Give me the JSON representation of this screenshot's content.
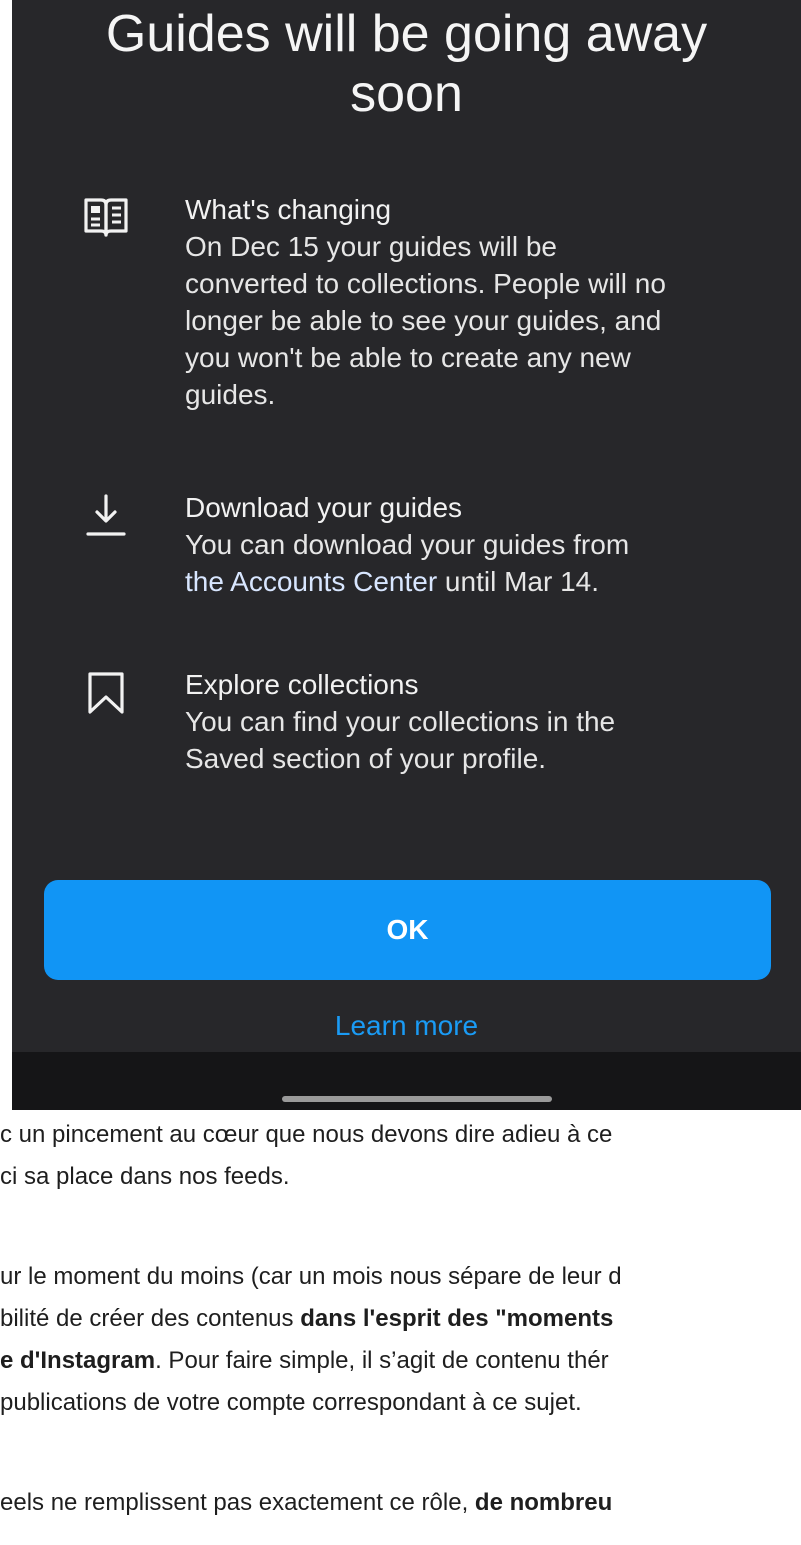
{
  "dialog": {
    "title_line1": "Guides will be going away",
    "title_line2": "soon",
    "items": [
      {
        "icon": "guide-book-icon",
        "heading": "What's changing",
        "body_lines": [
          "On Dec 15 your guides will be",
          "converted to collections. People will no",
          "longer be able to see your guides, and",
          "you won't be able to create any new",
          "guides."
        ]
      },
      {
        "icon": "download-icon",
        "heading": "Download your guides",
        "body_line1": "You can download your guides from",
        "body_line2_link": "the Accounts Center",
        "body_line2_rest": " until Mar 14."
      },
      {
        "icon": "bookmark-icon",
        "heading": "Explore collections",
        "body_lines": [
          "You can find your collections in the",
          "Saved section of your profile."
        ]
      }
    ],
    "ok_label": "OK",
    "learn_more_label": "Learn more"
  },
  "article": {
    "p1_line1": "c un pincement au cœur que nous devons dire adieu à ce",
    "p1_line2": "ci sa place dans nos feeds.",
    "p2_line1": "ur le moment du moins (car un mois nous sépare de leur d",
    "p2_line2_a": "bilité de créer des contenus ",
    "p2_line2_bold": "dans l'esprit des \"moments",
    "p2_line3_bold": "e d'Instagram",
    "p2_line3_b": ". Pour faire simple, il s’agit de contenu thér",
    "p2_line4": " publications de votre compte correspondant à ce sujet.",
    "p3_line1_a": "eels ne remplissent pas exactement ce rôle, ",
    "p3_line1_bold": "de nombreu"
  },
  "colors": {
    "dialog_bg": "#27272a",
    "accent": "#1195f5",
    "link": "#1a9bf5"
  }
}
